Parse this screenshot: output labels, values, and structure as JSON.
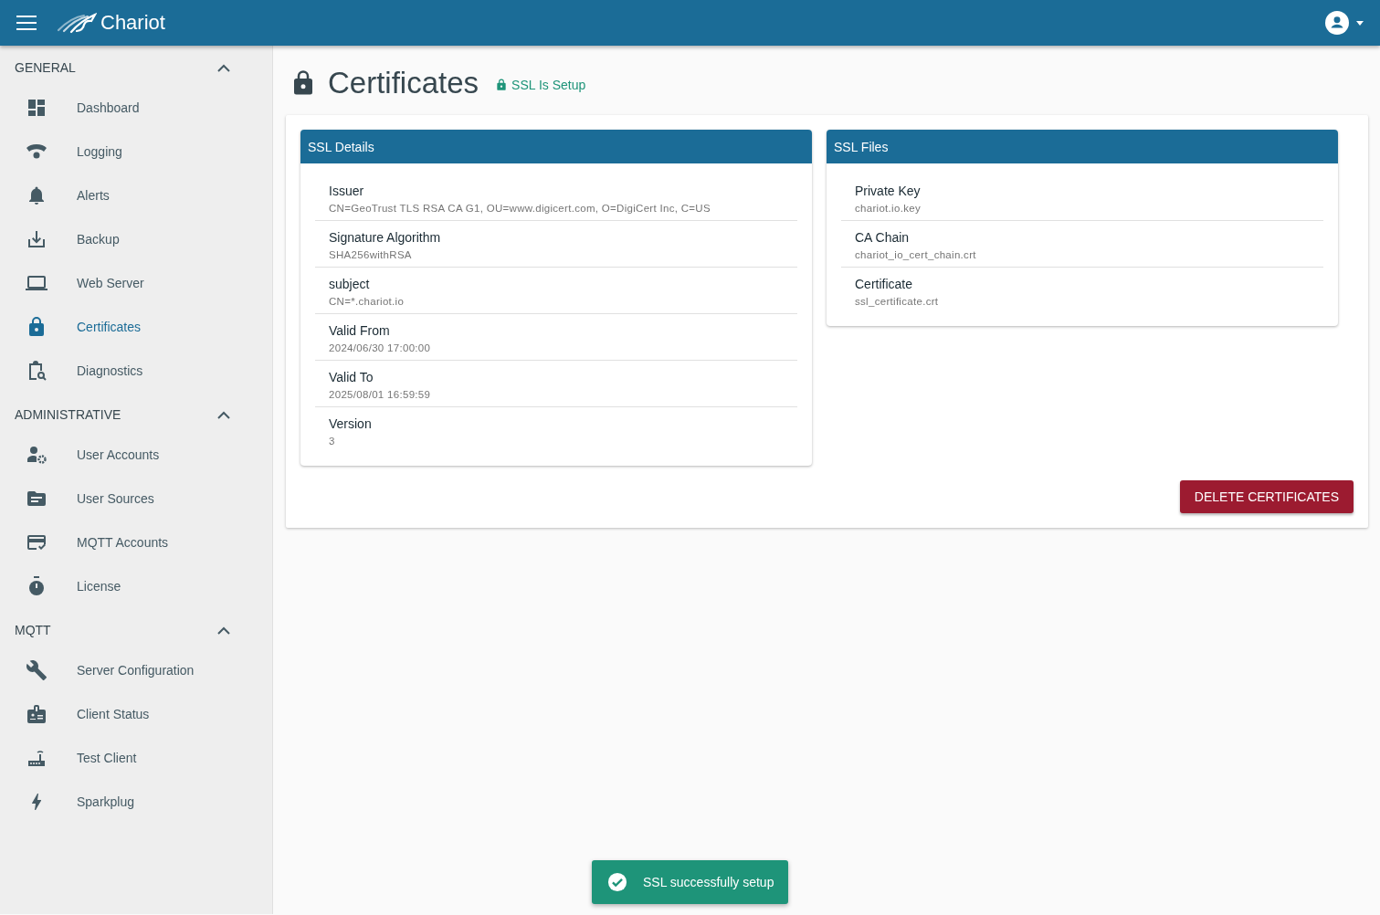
{
  "app_bar": {
    "title": "Chariot"
  },
  "sidebar": {
    "sections": [
      {
        "title": "GENERAL",
        "expanded": true,
        "items": [
          {
            "label": "Dashboard",
            "selected": false
          },
          {
            "label": "Logging",
            "selected": false
          },
          {
            "label": "Alerts",
            "selected": false
          },
          {
            "label": "Backup",
            "selected": false
          },
          {
            "label": "Web Server",
            "selected": false
          },
          {
            "label": "Certificates",
            "selected": true
          },
          {
            "label": "Diagnostics",
            "selected": false
          }
        ]
      },
      {
        "title": "ADMINISTRATIVE",
        "expanded": true,
        "items": [
          {
            "label": "User Accounts",
            "selected": false
          },
          {
            "label": "User Sources",
            "selected": false
          },
          {
            "label": "MQTT Accounts",
            "selected": false
          },
          {
            "label": "License",
            "selected": false
          }
        ]
      },
      {
        "title": "MQTT",
        "expanded": true,
        "items": [
          {
            "label": "Server Configuration",
            "selected": false
          },
          {
            "label": "Client Status",
            "selected": false
          },
          {
            "label": "Test Client",
            "selected": false
          },
          {
            "label": "Sparkplug",
            "selected": false
          }
        ]
      }
    ]
  },
  "page": {
    "title": "Certificates",
    "status": "SSL Is Setup"
  },
  "cards": [
    {
      "title": "SSL Details",
      "rows": [
        {
          "label": "Issuer",
          "value": "CN=GeoTrust TLS RSA CA G1, OU=www.digicert.com, O=DigiCert Inc, C=US"
        },
        {
          "label": "Signature Algorithm",
          "value": "SHA256withRSA"
        },
        {
          "label": "subject",
          "value": "CN=*.chariot.io"
        },
        {
          "label": "Valid From",
          "value": "2024/06/30 17:00:00"
        },
        {
          "label": "Valid To",
          "value": "2025/08/01 16:59:59"
        },
        {
          "label": "Version",
          "value": "3"
        }
      ]
    },
    {
      "title": "SSL Files",
      "rows": [
        {
          "label": "Private Key",
          "value": "chariot.io.key"
        },
        {
          "label": "CA Chain",
          "value": "chariot_io_cert_chain.crt"
        },
        {
          "label": "Certificate",
          "value": "ssl_certificate.crt"
        }
      ]
    }
  ],
  "delete_button": {
    "label": "DELETE CERTIFICATES"
  },
  "toast": {
    "message": "SSL successfully setup"
  }
}
